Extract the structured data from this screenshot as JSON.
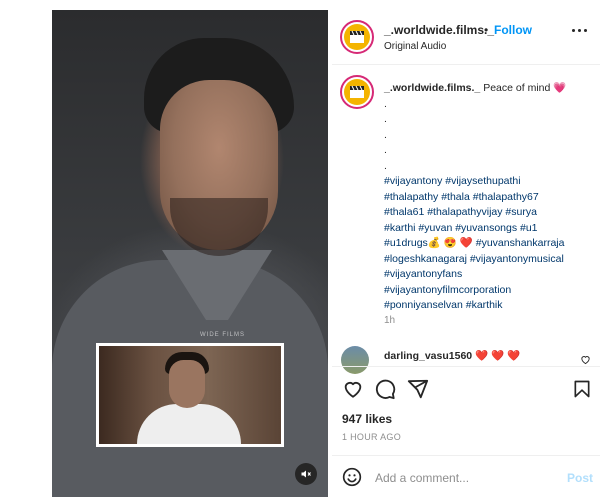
{
  "post": {
    "account": "_.worldwide.films._",
    "dot": "•",
    "follow_label": "Follow",
    "audio": "Original Audio",
    "watermark": "WIDE FILMS"
  },
  "caption": {
    "username": "_.worldwide.films._",
    "text": "Peace of mind 💗",
    "dots": [
      ".",
      ".",
      ".",
      ".",
      "."
    ],
    "tag_lines": [
      "#vijayantony #vijaysethupathi",
      "#thalapathy #thala #thalapathy67",
      "#thala61 #thalapathyvijay #surya",
      "#karthi #yuvan #yuvansongs #u1",
      "#u1drugs💰 😍 ❤️ #yuvanshankarraja",
      "#logeshkanagaraj #vijayantonymusical",
      "#vijayantonyfans",
      "#vijayantonyfilmcorporation",
      "#ponniyanselvan #karthik"
    ],
    "time": "1h"
  },
  "comment": {
    "username": "darling_vasu1560",
    "text": "❤️ ❤️ ❤️"
  },
  "stats": {
    "likes": "947 likes",
    "ago": "1 HOUR AGO"
  },
  "composer": {
    "placeholder": "Add a comment...",
    "post_label": "Post"
  },
  "icons": {
    "actions": [
      "heart-icon",
      "comment-icon",
      "share-icon",
      "bookmark-icon"
    ],
    "mute": "volume-mute-icon",
    "emoji": "emoji-icon",
    "more": "more-options-icon"
  },
  "colors": {
    "link": "#00376b",
    "follow": "#0095f6",
    "post_disabled": "#b2dffc",
    "ring": "#d62976",
    "heart": "#ed4956",
    "muted": "#8e8e8e"
  }
}
